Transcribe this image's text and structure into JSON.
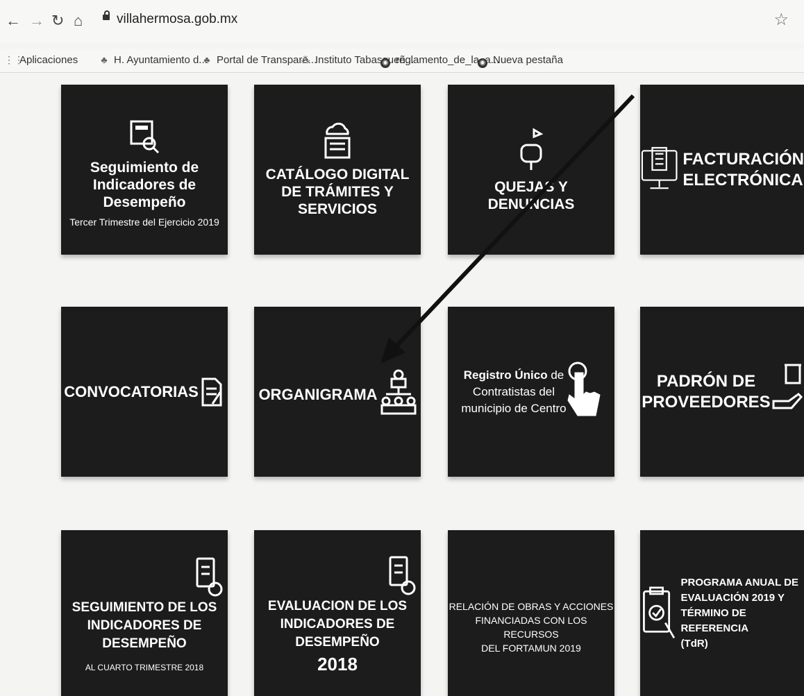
{
  "browser": {
    "url": "villahermosa.gob.mx",
    "bookmarks": [
      "Aplicaciones",
      "H. Ayuntamiento d...",
      "Portal de Transpare...",
      "Instituto Tabasqueñ...",
      "reglamento_de_la_a...",
      "Nueva pestaña"
    ]
  },
  "tiles": {
    "indicadores_2019": {
      "title1": "Seguimiento de",
      "title2": "Indicadores de Desempeño",
      "subtitle": "Tercer Trimestre del Ejercicio 2019",
      "icon": "document-magnifier-icon"
    },
    "catalogo": {
      "title1": "CATÁLOGO DIGITAL",
      "title2": "DE TRÁMITES Y SERVICIOS",
      "icon": "cloud-documents-icon"
    },
    "quejas": {
      "title1": "QUEJAS Y",
      "title2": "DENUNCIAS",
      "icon": "mailbox-icon"
    },
    "facturacion": {
      "title1": "FACTURACIÓN",
      "title2": "ELECTRÓNICA",
      "icon": "computer-document-icon"
    },
    "convocatorias": {
      "title": "CONVOCATORIAS",
      "icon": "document-pencil-icon"
    },
    "organigrama": {
      "title": "ORGANIGRAMA",
      "icon": "org-chart-icon"
    },
    "registro": {
      "line1_bold": "Registro Único",
      "line1_rest": " de",
      "line2": "Contratistas del",
      "line3": "municipio de Centro",
      "icon": "hand-pointer-icon"
    },
    "padron": {
      "title1": "PADRÓN DE",
      "title2": "PROVEEDORES",
      "icon": "hand-box-icon"
    },
    "seguimiento_2018": {
      "title1": "SEGUIMIENTO DE LOS",
      "title2": "INDICADORES DE DESEMPEÑO",
      "subtitle": "AL CUARTO TRIMESTRE 2018",
      "icon": "checklist-gear-icon"
    },
    "evaluacion_2018": {
      "title1": "EVALUACION DE LOS",
      "title2": "INDICADORES DE DESEMPEÑO",
      "year": "2018",
      "icon": "checklist-gear-icon"
    },
    "fortamun": {
      "line1": "RELACIÓN DE OBRAS Y ACCIONES",
      "line2": "FINANCIADAS CON LOS RECURSOS",
      "line3": "DEL FORTAMUN 2019"
    },
    "programa": {
      "line1": "PROGRAMA ANUAL DE",
      "line2": "EVALUACIÓN 2019 Y",
      "line3": "TÉRMINO DE REFERENCIA",
      "line4": "(TdR)",
      "icon": "clipboard-check-icon"
    }
  },
  "colors": {
    "tile_bg": "#1c1c1c",
    "page_bg": "#f4f4f2",
    "text": "#ffffff"
  }
}
